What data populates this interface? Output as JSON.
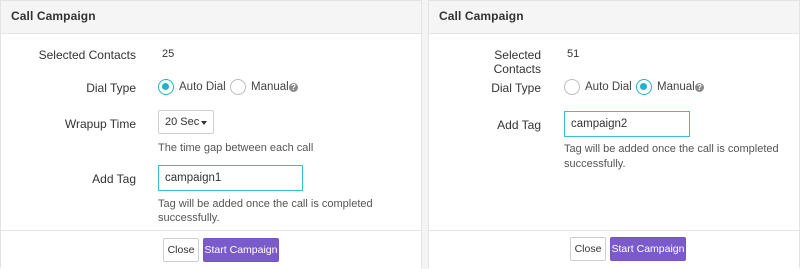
{
  "colors": {
    "accent": "#1fb3c7",
    "primary_button": "#7b5bcb",
    "header_bg": "#f5f5f5"
  },
  "panels": [
    {
      "title": "Call Campaign",
      "selected_contacts_label": "Selected Contacts",
      "selected_contacts_value": "25",
      "dial_type_label": "Dial Type",
      "dial_options": [
        {
          "label": "Auto Dial",
          "selected": true
        },
        {
          "label": "Manual",
          "selected": false
        }
      ],
      "help_icon": "question-circle-icon",
      "wrapup_label": "Wrapup Time",
      "wrapup_value": "20 Sec",
      "wrapup_help": "The time gap between each call",
      "tag_label": "Add Tag",
      "tag_value": "campaign1",
      "tag_help": "Tag will be added once the call is completed successfully.",
      "close_label": "Close",
      "start_label": "Start Campaign"
    },
    {
      "title": "Call Campaign",
      "selected_contacts_label": "Selected Contacts",
      "selected_contacts_value": "51",
      "dial_type_label": "Dial Type",
      "dial_options": [
        {
          "label": "Auto Dial",
          "selected": false
        },
        {
          "label": "Manual",
          "selected": true
        }
      ],
      "help_icon": "question-circle-icon",
      "tag_label": "Add Tag",
      "tag_value": "campaign2",
      "tag_help_line1": "Tag will be added once the call is completed",
      "tag_help_line2": "successfully.",
      "close_label": "Close",
      "start_label": "Start Campaign"
    }
  ]
}
